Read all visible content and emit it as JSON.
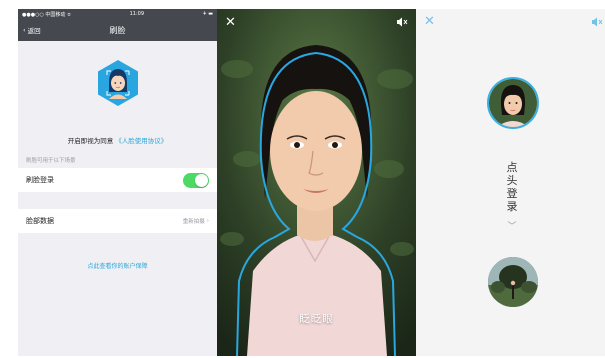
{
  "settings": {
    "status_carrier": "●●●○○ 中国移动 ≎",
    "status_time": "11:09",
    "status_right": "✈ ▬",
    "back_label": "返回",
    "title": "刷脸",
    "agree_text": "开启即视为同意",
    "agree_link": "《人脸使用协议》",
    "section_hint": "刷脸可用于以下场景",
    "row_login": "刷脸登录",
    "row_data": "脸部数据",
    "row_data_value": "重新拍摄",
    "footer_link": "点此查看你的账户保障",
    "accent": "#2aa7d9",
    "toggle_on": true,
    "toggle_color": "#4cd964"
  },
  "camera": {
    "prompt": "眨眨眼",
    "close_icon": "close-icon",
    "sound_icon": "speaker-mute-icon",
    "outline_color": "#29a7e0"
  },
  "nod_login": {
    "vertical_text": "点头登录",
    "chevron": "﹀",
    "close_icon": "close-icon",
    "sound_icon": "speaker-mute-icon",
    "ring_color": "#3ab0e2"
  }
}
